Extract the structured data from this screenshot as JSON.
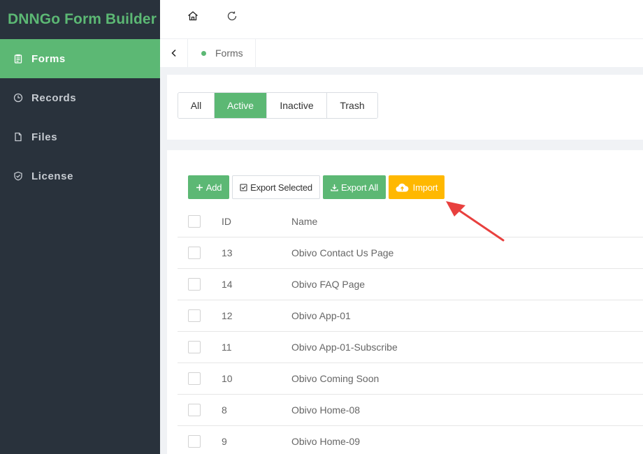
{
  "sidebar": {
    "brand": "DNNGo Form Builder",
    "items": [
      {
        "label": "Forms",
        "icon": "clipboard-icon",
        "active": true
      },
      {
        "label": "Records",
        "icon": "clock-icon",
        "active": false
      },
      {
        "label": "Files",
        "icon": "file-icon",
        "active": false
      },
      {
        "label": "License",
        "icon": "shield-check-icon",
        "active": false
      }
    ]
  },
  "topbar": {
    "icons": [
      "home-icon",
      "refresh-icon"
    ]
  },
  "tabsbar": {
    "current_tab": "Forms"
  },
  "filter": {
    "segments": [
      {
        "label": "All",
        "active": false
      },
      {
        "label": "Active",
        "active": true
      },
      {
        "label": "Inactive",
        "active": false
      },
      {
        "label": "Trash",
        "active": false
      }
    ]
  },
  "toolbar": {
    "add": "Add",
    "export_selected": "Export Selected",
    "export_all": "Export All",
    "import": "Import"
  },
  "table": {
    "columns": [
      "ID",
      "Name"
    ],
    "rows": [
      {
        "id": "13",
        "name": "Obivo Contact Us Page"
      },
      {
        "id": "14",
        "name": "Obivo FAQ Page"
      },
      {
        "id": "12",
        "name": "Obivo App-01"
      },
      {
        "id": "11",
        "name": "Obivo App-01-Subscribe"
      },
      {
        "id": "10",
        "name": "Obivo Coming Soon"
      },
      {
        "id": "8",
        "name": "Obivo Home-08"
      },
      {
        "id": "9",
        "name": "Obivo Home-09"
      }
    ]
  },
  "colors": {
    "accent": "#5cb874",
    "sidebar_bg": "#29323c",
    "import_button": "#ffb800",
    "annotation_arrow": "#e8403e"
  }
}
